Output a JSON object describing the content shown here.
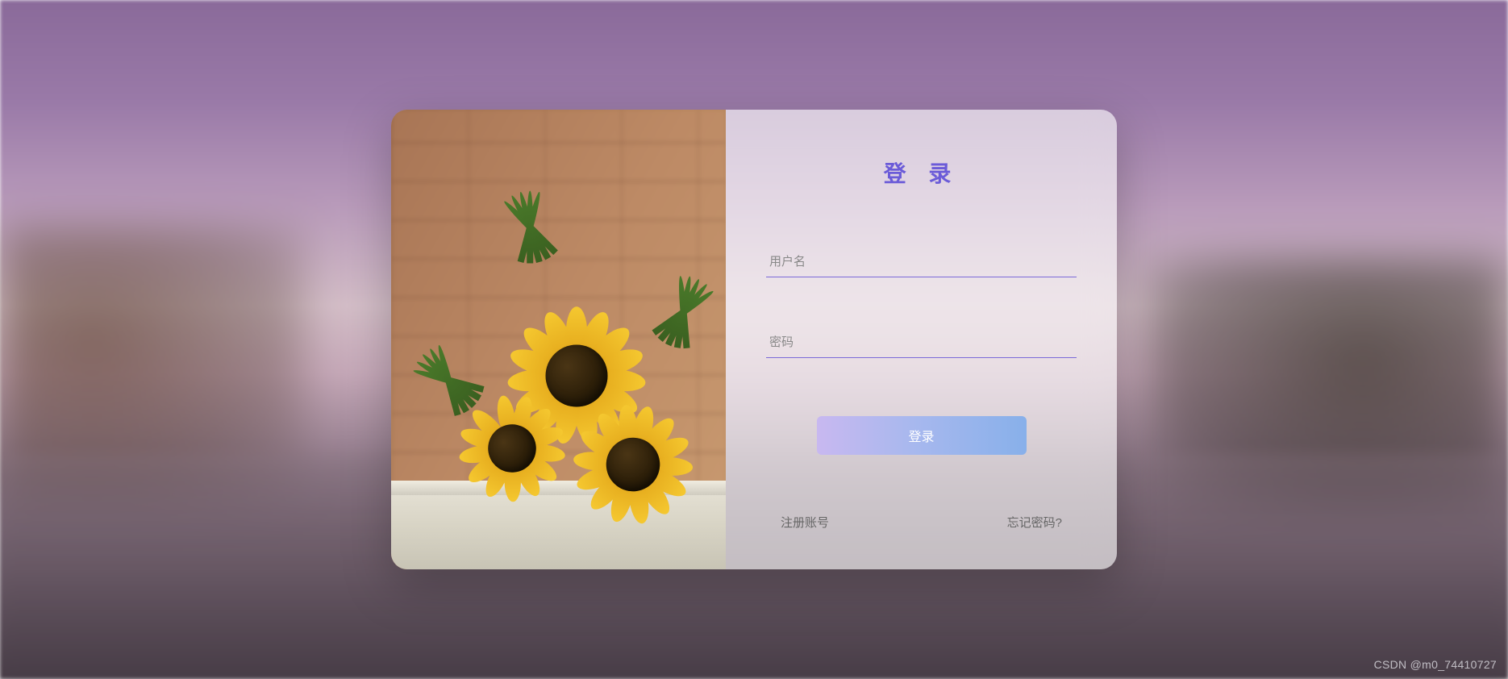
{
  "form": {
    "title": "登 录",
    "username": {
      "placeholder": "用户名",
      "value": ""
    },
    "password": {
      "placeholder": "密码",
      "value": ""
    },
    "submit_label": "登录"
  },
  "footer": {
    "register_label": "注册账号",
    "forgot_label": "忘记密码?"
  },
  "watermark": "CSDN @m0_74410727"
}
